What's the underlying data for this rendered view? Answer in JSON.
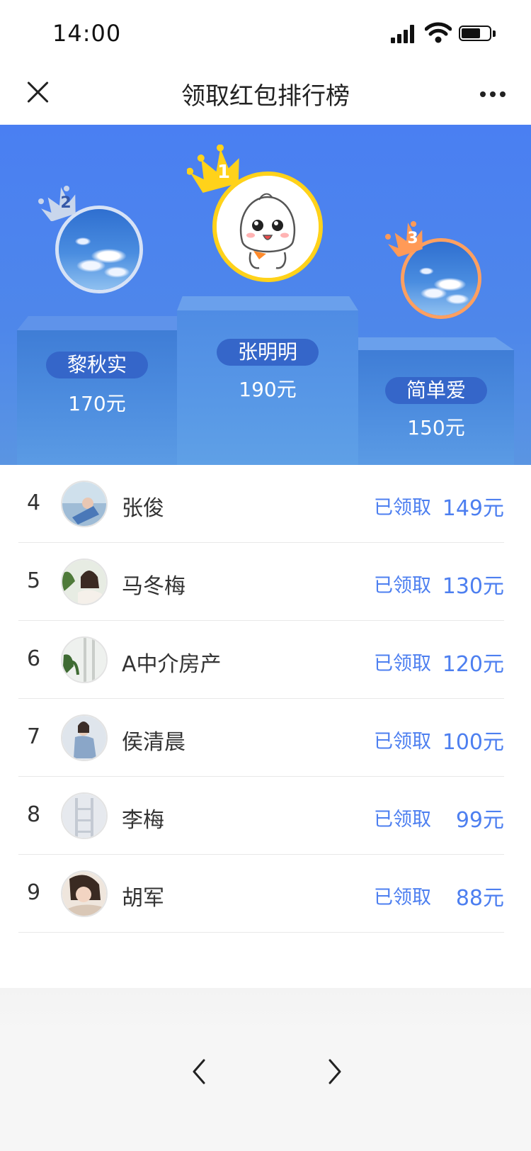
{
  "status_bar": {
    "time": "14:00"
  },
  "nav": {
    "title": "领取红包排行榜"
  },
  "podium": {
    "first": {
      "rank": "1",
      "name": "张明明",
      "amount": "190元"
    },
    "second": {
      "rank": "2",
      "name": "黎秋实",
      "amount": "170元"
    },
    "third": {
      "rank": "3",
      "name": "简单爱",
      "amount": "150元"
    }
  },
  "list": [
    {
      "rank": "4",
      "name": "张俊",
      "status": "已领取",
      "amount": "149元"
    },
    {
      "rank": "5",
      "name": "马冬梅",
      "status": "已领取",
      "amount": "130元"
    },
    {
      "rank": "6",
      "name": "A中介房产",
      "status": "已领取",
      "amount": "120元"
    },
    {
      "rank": "7",
      "name": "侯清晨",
      "status": "已领取",
      "amount": "100元"
    },
    {
      "rank": "8",
      "name": "李梅",
      "status": "已领取",
      "amount": "99元"
    },
    {
      "rank": "9",
      "name": "胡军",
      "status": "已领取",
      "amount": "88元"
    }
  ],
  "colors": {
    "accent": "#4d7ff0",
    "gold": "#ffd21a",
    "silver": "#c9d6ec",
    "bronze": "#ff9a57"
  }
}
